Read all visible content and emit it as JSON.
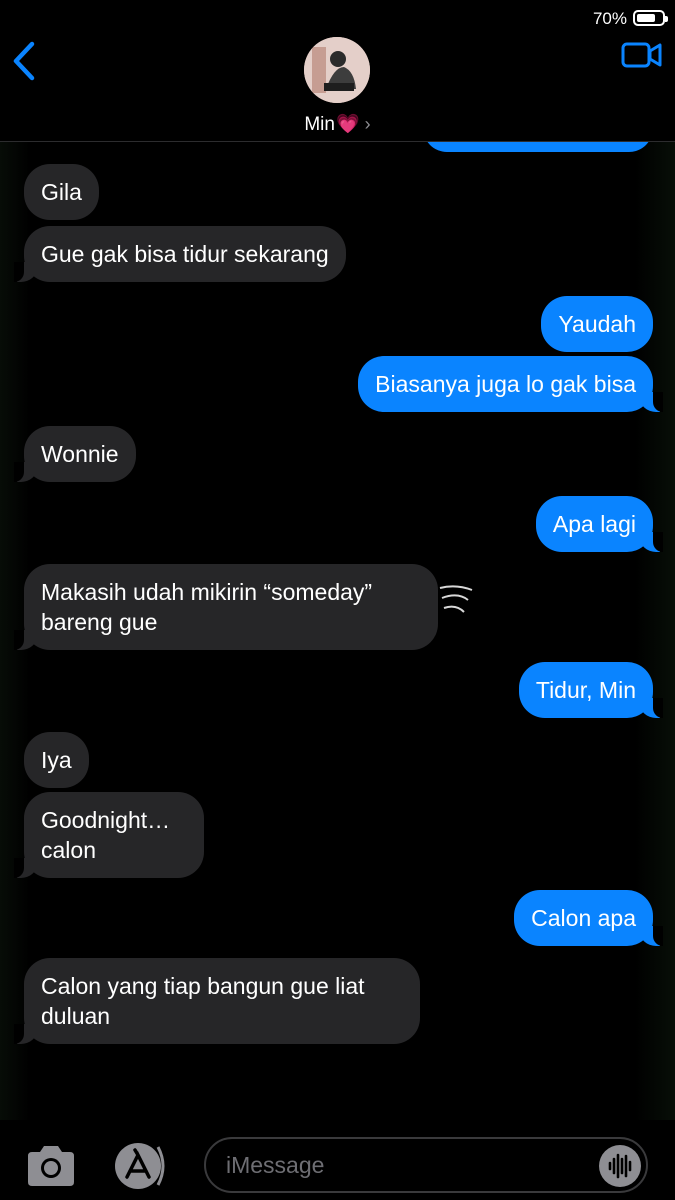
{
  "status": {
    "battery_percent": "70%",
    "battery_level": 0.7
  },
  "header": {
    "contact_name": "Min",
    "contact_emoji": "💗",
    "chevron": "›",
    "back_icon": "chevron-left-icon",
    "video_icon": "video-camera-icon"
  },
  "messages": [
    {
      "from": "them",
      "text": "Gila"
    },
    {
      "from": "them",
      "text": "Gue gak bisa tidur sekarang"
    },
    {
      "from": "me",
      "text": "Yaudah"
    },
    {
      "from": "me",
      "text": "Biasanya juga lo gak bisa"
    },
    {
      "from": "them",
      "text": "Wonnie"
    },
    {
      "from": "me",
      "text": "Apa lagi"
    },
    {
      "from": "them",
      "text": "Makasih udah mikirin “someday” bareng gue"
    },
    {
      "from": "me",
      "text": "Tidur, Min"
    },
    {
      "from": "them",
      "text": "Iya"
    },
    {
      "from": "them",
      "text": "Goodnight… calon"
    },
    {
      "from": "me",
      "text": "Calon apa"
    },
    {
      "from": "them",
      "text": "Calon yang tiap bangun gue liat duluan"
    }
  ],
  "composer": {
    "placeholder": "iMessage",
    "camera_icon": "camera-icon",
    "appstore_icon": "app-store-icon",
    "audio_icon": "audio-waveform-icon"
  },
  "colors": {
    "outgoing_bubble": "#0a84ff",
    "incoming_bubble": "#262628",
    "accent": "#0a84ff",
    "background": "#000000"
  }
}
